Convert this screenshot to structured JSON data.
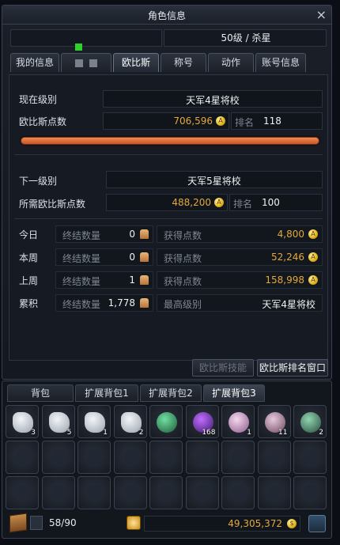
{
  "window": {
    "title": "角色信息",
    "close": "×"
  },
  "profile": {
    "level_class": "50级 / 杀星"
  },
  "tabs": [
    "我的信息",
    "",
    "欧比斯",
    "称号",
    "动作",
    "账号信息"
  ],
  "active_tab": "欧比斯",
  "current": {
    "level_label": "现在级别",
    "level_value": "天军4星将校",
    "points_label": "欧比斯点数",
    "points_value": "706,596",
    "rank_label": "排名",
    "rank_value": "118"
  },
  "next": {
    "level_label": "下一级别",
    "level_value": "天军5星将校",
    "points_label": "所需欧比斯点数",
    "points_value": "488,200",
    "rank_label": "排名",
    "rank_value": "100"
  },
  "stats": {
    "rows": [
      {
        "label": "今日",
        "kills_label": "终结数量",
        "kills": "0",
        "points_label": "获得点数",
        "points": "4,800"
      },
      {
        "label": "本周",
        "kills_label": "终结数量",
        "kills": "0",
        "points_label": "获得点数",
        "points": "52,246"
      },
      {
        "label": "上周",
        "kills_label": "终结数量",
        "kills": "1",
        "points_label": "获得点数",
        "points": "158,998"
      },
      {
        "label": "累积",
        "kills_label": "终结数量",
        "kills": "1,778",
        "points_label": "最高级别",
        "points": "天军4星将校"
      }
    ]
  },
  "buttons": {
    "skill": "欧比斯技能",
    "rank_window": "欧比斯排名窗口"
  },
  "inventory": {
    "tabs": [
      "背包",
      "扩展背包1",
      "扩展背包2",
      "扩展背包3"
    ],
    "active_tab": "扩展背包3",
    "items": [
      {
        "icon": "silver-ore-icon",
        "qty": "3"
      },
      {
        "icon": "silver-ore-icon",
        "qty": "5"
      },
      {
        "icon": "silver-ore-icon",
        "qty": "1"
      },
      {
        "icon": "silver-ore-icon",
        "qty": "2"
      },
      {
        "icon": "green-orb-icon",
        "qty": ""
      },
      {
        "icon": "purple-crystal-icon",
        "qty": "168"
      },
      {
        "icon": "pink-gem-icon",
        "qty": "1"
      },
      {
        "icon": "pink-stone-icon",
        "qty": "11"
      },
      {
        "icon": "green-amulet-icon",
        "qty": "2"
      }
    ],
    "capacity": "58/90",
    "gold": "49,305,372"
  }
}
